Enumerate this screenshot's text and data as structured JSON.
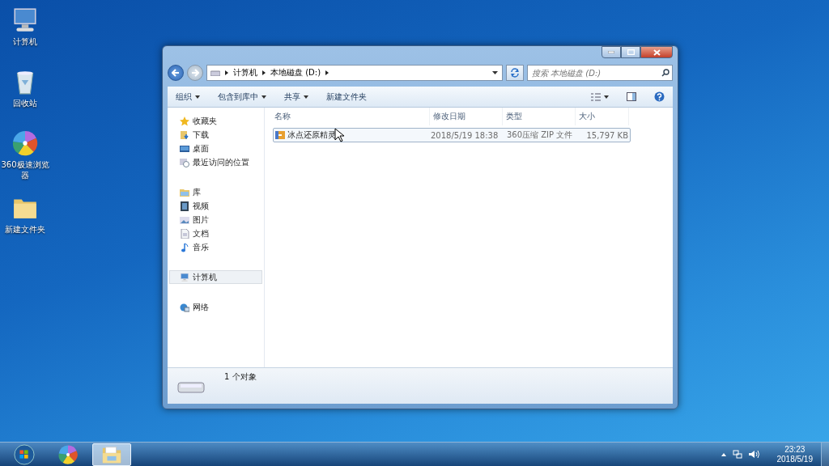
{
  "desktop_icons": [
    {
      "label": "计算机",
      "kind": "computer"
    },
    {
      "label": "回收站",
      "kind": "recycle"
    },
    {
      "label": "360极速浏览器",
      "kind": "browser"
    },
    {
      "label": "新建文件夹",
      "kind": "folder"
    }
  ],
  "window": {
    "breadcrumb": [
      "计算机",
      "本地磁盘 (D:)"
    ],
    "search": {
      "placeholder": "搜索 本地磁盘 (D:)"
    },
    "toolbar": [
      {
        "label": "组织",
        "dropdown": true
      },
      {
        "label": "包含到库中",
        "dropdown": true
      },
      {
        "label": "共享",
        "dropdown": true
      },
      {
        "label": "新建文件夹",
        "dropdown": false
      }
    ],
    "sidebar": [
      {
        "label": "收藏夹",
        "kind": "star",
        "selected": false,
        "children": [
          {
            "label": "下载",
            "kind": "download"
          },
          {
            "label": "桌面",
            "kind": "desktop"
          },
          {
            "label": "最近访问的位置",
            "kind": "recent"
          }
        ]
      },
      {
        "label": "库",
        "kind": "library",
        "selected": false,
        "children": [
          {
            "label": "视频",
            "kind": "video"
          },
          {
            "label": "图片",
            "kind": "image"
          },
          {
            "label": "文档",
            "kind": "doc"
          },
          {
            "label": "音乐",
            "kind": "music"
          }
        ]
      },
      {
        "label": "计算机",
        "kind": "computer",
        "selected": true
      },
      {
        "label": "网络",
        "kind": "network",
        "selected": false
      }
    ],
    "table": {
      "columns": [
        "名称",
        "修改日期",
        "类型",
        "大小"
      ],
      "rows": [
        {
          "name": "冰点还原精灵",
          "modified": "2018/5/19 18:38",
          "type": "360压缩 ZIP 文件",
          "size": "15,797 KB",
          "selected": true
        }
      ]
    },
    "status_bar": {
      "text": "1 个对象"
    }
  },
  "taskbar": {
    "items": [
      {
        "kind": "start",
        "selected": false
      },
      {
        "kind": "browser",
        "selected": false
      },
      {
        "kind": "explorer",
        "selected": true
      }
    ],
    "clock": {
      "time": "23:23",
      "date": "2018/5/19"
    }
  }
}
